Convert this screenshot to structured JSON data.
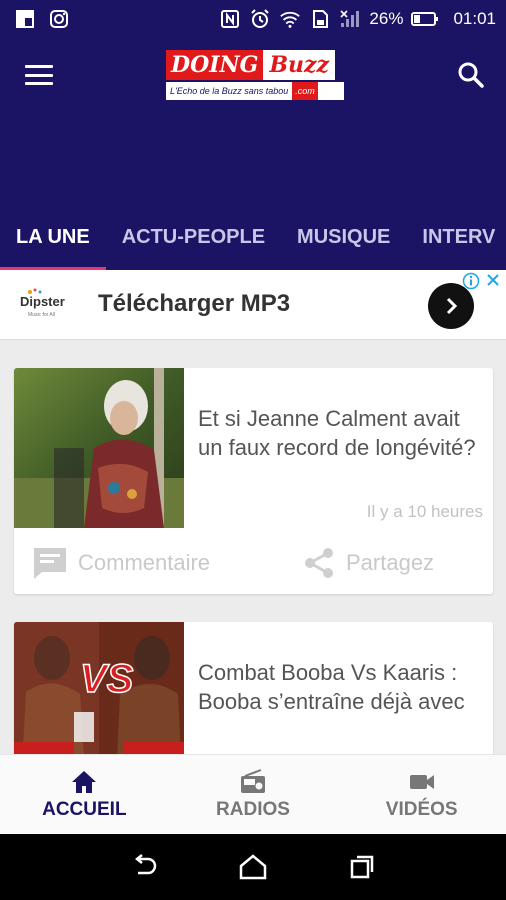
{
  "status_bar": {
    "battery": "26%",
    "time": "01:01"
  },
  "logo": {
    "doing": "DOING",
    "buzz": "Buzz",
    "tagline": "L'Echo de la Buzz sans tabou",
    "com": ".com"
  },
  "tabs": [
    {
      "label": "LA UNE"
    },
    {
      "label": "ACTU-PEOPLE"
    },
    {
      "label": "MUSIQUE"
    },
    {
      "label": "INTERV"
    }
  ],
  "ad": {
    "brand": "Dipster",
    "brand_sub": "Music for All",
    "title": "Télécharger MP3"
  },
  "articles": [
    {
      "title": "Et si Jeanne Calment avait un faux record de longévité?",
      "time": "Il y a 10 heures",
      "comment_label": "Commentaire",
      "share_label": "Partagez"
    },
    {
      "title": "Combat Booba Vs Kaaris : Booba s’entraîne déjà avec",
      "vs_text": "VS"
    }
  ],
  "bottom_nav": [
    {
      "label": "ACCUEIL",
      "icon": "home-icon"
    },
    {
      "label": "RADIOS",
      "icon": "radio-icon"
    },
    {
      "label": "VIDÉOS",
      "icon": "videocam-icon"
    }
  ],
  "colors": {
    "primary": "#1b1464",
    "accent": "#e8366e",
    "brand_red": "#e01a1a"
  }
}
